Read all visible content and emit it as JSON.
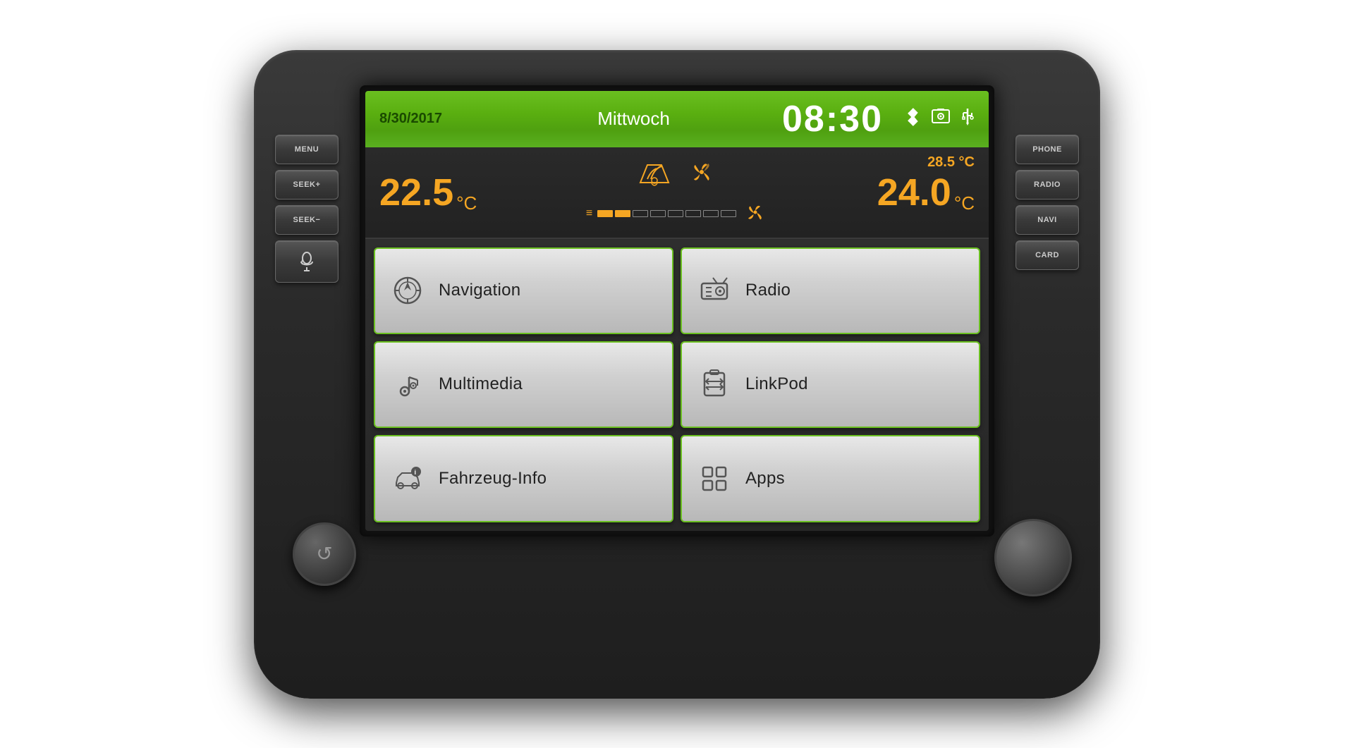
{
  "header": {
    "date": "8/30/2017",
    "day": "Mittwoch",
    "time": "08:30",
    "bluetooth_icon": "bluetooth",
    "media_icon": "music-note",
    "usb_icon": "usb"
  },
  "climate": {
    "left_temp": "22.5",
    "left_unit": "°C",
    "right_temp": "24.0",
    "right_unit": "°C",
    "top_right_temp": "28.5 °C",
    "fan_active_segments": 2,
    "fan_total_segments": 8
  },
  "menu": {
    "buttons": [
      {
        "id": "navigation",
        "label": "Navigation",
        "icon": "compass"
      },
      {
        "id": "radio",
        "label": "Radio",
        "icon": "radio"
      },
      {
        "id": "multimedia",
        "label": "Multimedia",
        "icon": "multimedia"
      },
      {
        "id": "linkpod",
        "label": "LinkPod",
        "icon": "linkpod"
      },
      {
        "id": "fahrzeug-info",
        "label": "Fahrzeug-Info",
        "icon": "car-info"
      },
      {
        "id": "apps",
        "label": "Apps",
        "icon": "apps"
      }
    ]
  },
  "side_buttons": {
    "left": [
      {
        "id": "menu",
        "label": "MENU"
      },
      {
        "id": "seek-plus",
        "label": "SEEK+"
      },
      {
        "id": "seek-minus",
        "label": "SEEK−"
      },
      {
        "id": "voice",
        "label": "((ξ"
      }
    ],
    "right": [
      {
        "id": "phone",
        "label": "PHONE"
      },
      {
        "id": "radio",
        "label": "RADIO"
      },
      {
        "id": "navi",
        "label": "NAVI"
      },
      {
        "id": "card",
        "label": "CARD"
      }
    ]
  }
}
